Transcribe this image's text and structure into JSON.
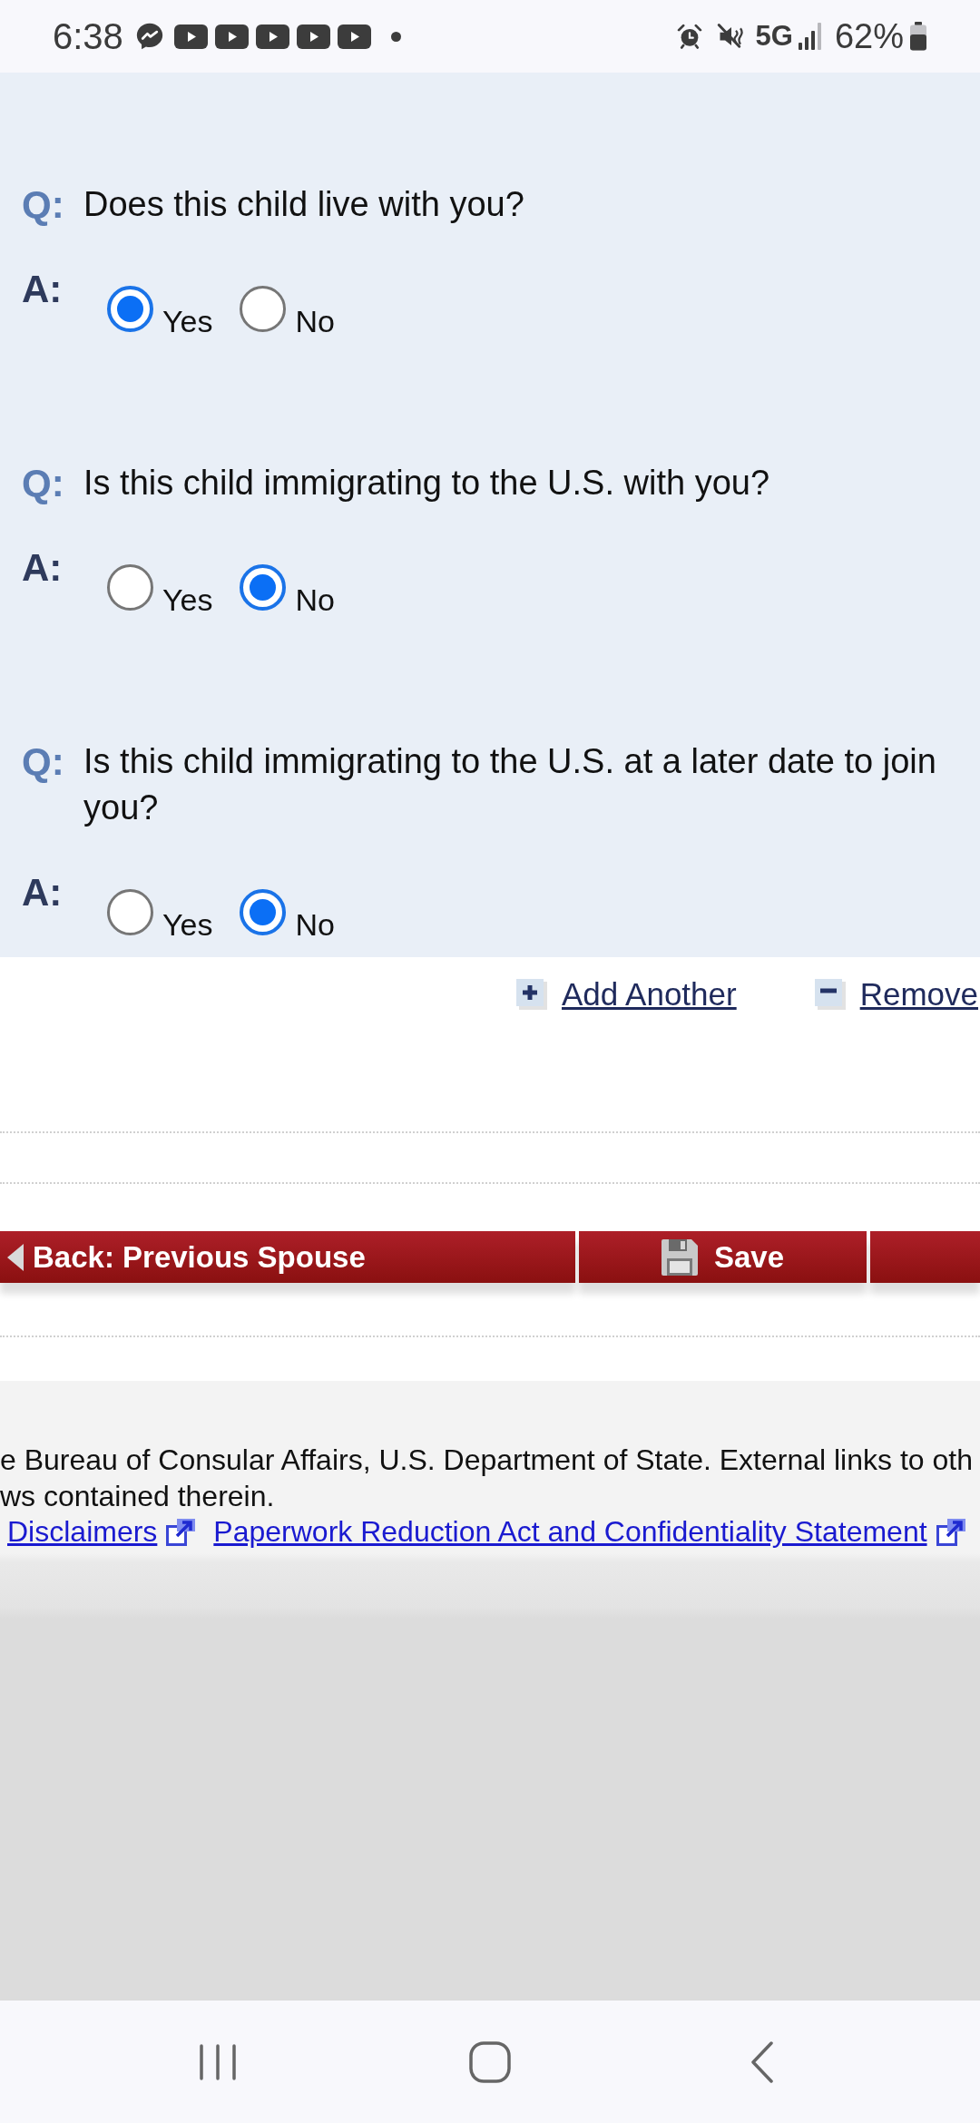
{
  "status_bar": {
    "time": "6:38",
    "network": "5G",
    "battery": "62%"
  },
  "questions": [
    {
      "q_label": "Q:",
      "text": "Does this child live with you?",
      "a_label": "A:",
      "options": [
        {
          "label": "Yes",
          "selected": true
        },
        {
          "label": "No",
          "selected": false
        }
      ]
    },
    {
      "q_label": "Q:",
      "text": "Is this child immigrating to the U.S. with you?",
      "a_label": "A:",
      "options": [
        {
          "label": "Yes",
          "selected": false
        },
        {
          "label": "No",
          "selected": true
        }
      ]
    },
    {
      "q_label": "Q:",
      "text": "Is this child immigrating to the U.S. at a later date to join you?",
      "a_label": "A:",
      "options": [
        {
          "label": "Yes",
          "selected": false
        },
        {
          "label": "No",
          "selected": true
        }
      ]
    }
  ],
  "row_actions": [
    {
      "kind": "add",
      "label": "Add Another"
    },
    {
      "kind": "remove",
      "label": "Remove"
    }
  ],
  "nav_buttons": [
    {
      "kind": "back",
      "label": "Back: Previous Spouse"
    },
    {
      "kind": "save",
      "label": "Save"
    },
    {
      "kind": "cut_off"
    }
  ],
  "footer": {
    "lines": [
      "e Bureau of Consular Affairs, U.S. Department of State. External links to oth",
      "ws contained therein."
    ],
    "links": [
      "Disclaimers",
      "Paperwork Reduction Act and Confidentiality Statement"
    ]
  }
}
